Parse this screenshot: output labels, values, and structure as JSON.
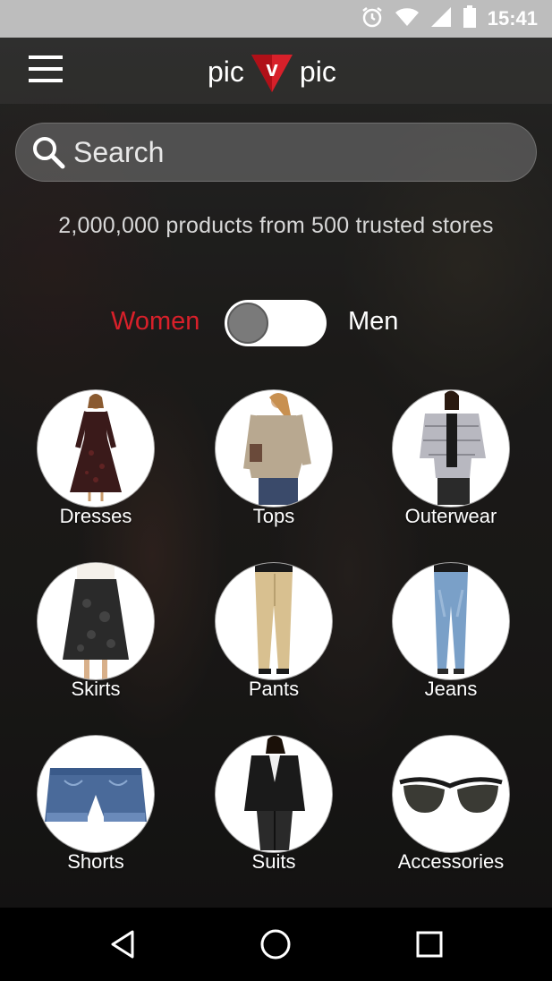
{
  "status_bar": {
    "time": "15:41",
    "icons": [
      "alarm-icon",
      "wifi-icon",
      "signal-icon",
      "battery-icon"
    ]
  },
  "app_bar": {
    "logo_left": "pic",
    "logo_right": "pic",
    "logo_mark_letter": "v",
    "logo_color": "#d8202a"
  },
  "search": {
    "placeholder": "Search"
  },
  "tagline": "2,000,000 products from 500 trusted stores",
  "gender_toggle": {
    "left_label": "Women",
    "right_label": "Men",
    "selected": "Women",
    "active_color": "#d8202a"
  },
  "categories": [
    {
      "label": "Dresses",
      "icon": "dress-image"
    },
    {
      "label": "Tops",
      "icon": "top-image"
    },
    {
      "label": "Outerwear",
      "icon": "jacket-image"
    },
    {
      "label": "Skirts",
      "icon": "skirt-image"
    },
    {
      "label": "Pants",
      "icon": "pants-image"
    },
    {
      "label": "Jeans",
      "icon": "jeans-image"
    },
    {
      "label": "Shorts",
      "icon": "shorts-image"
    },
    {
      "label": "Suits",
      "icon": "suit-image"
    },
    {
      "label": "Accessories",
      "icon": "sunglasses-image"
    }
  ],
  "nav_bar": {
    "buttons": [
      "back-icon",
      "home-icon",
      "recents-icon"
    ]
  }
}
